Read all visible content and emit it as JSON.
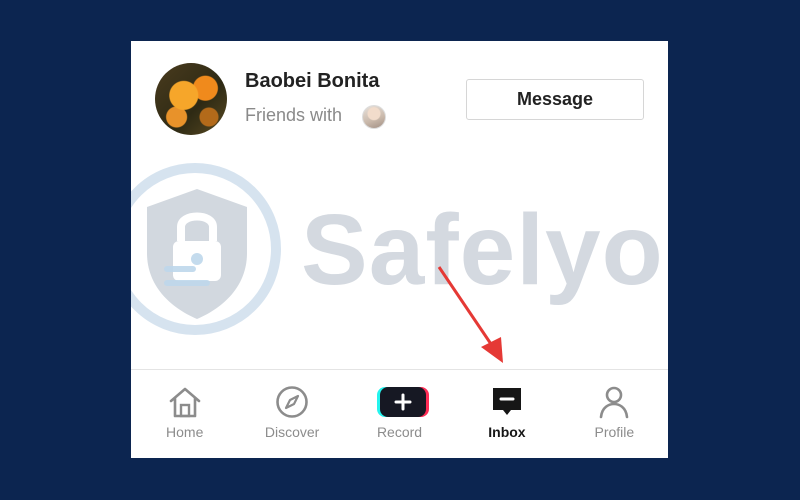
{
  "profile": {
    "name": "Baobei Bonita",
    "friends_label": "Friends with"
  },
  "actions": {
    "message_label": "Message"
  },
  "watermark": {
    "text": "Safelyo"
  },
  "nav": {
    "items": [
      {
        "label": "Home",
        "icon": "home-icon",
        "active": false
      },
      {
        "label": "Discover",
        "icon": "compass-icon",
        "active": false
      },
      {
        "label": "Record",
        "icon": "plus-icon",
        "active": false
      },
      {
        "label": "Inbox",
        "icon": "inbox-icon",
        "active": true
      },
      {
        "label": "Profile",
        "icon": "person-icon",
        "active": false
      }
    ]
  },
  "colors": {
    "background": "#0c2550",
    "arrow": "#e53935",
    "record_cyan": "#25f4ee",
    "record_pink": "#fe2c55"
  }
}
